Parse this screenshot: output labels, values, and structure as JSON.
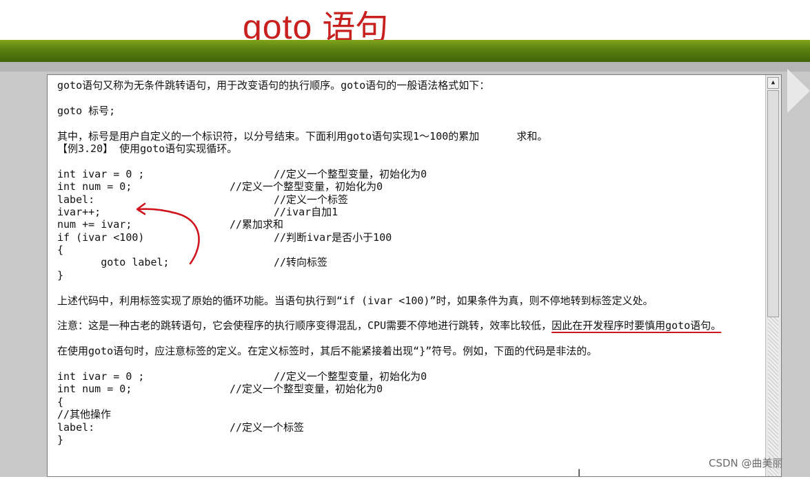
{
  "slide": {
    "title_latin": "goto",
    "title_cjk": "语句"
  },
  "doc": {
    "p1": "goto语句又称为无条件跳转语句，用于改变语句的执行顺序。goto语句的一般语法格式如下：",
    "syntax": "goto 标号;",
    "p2": "其中，标号是用户自定义的一个标识符，以分号结束。下面利用goto语句实现1～100的累加      求和。",
    "example_title": "【例3.20】 使用goto语句实现循环。",
    "code1": [
      {
        "code": "int ivar = 0 ;",
        "comment": "//定义一个整型变量，初始化为0",
        "col": "c1"
      },
      {
        "code": "int num = 0;",
        "comment": "//定义一个整型变量，初始化为0",
        "col": "c2"
      },
      {
        "code": "label:",
        "comment": "//定义一个标签",
        "col": "c1"
      },
      {
        "code": "ivar++;",
        "comment": "//ivar自加1",
        "col": "c1"
      },
      {
        "code": "num += ivar;",
        "comment": "//累加求和",
        "col": "c2"
      },
      {
        "code": "if (ivar <100)",
        "comment": "//判断ivar是否小于100",
        "col": "c1"
      },
      {
        "code": "{",
        "comment": "",
        "col": "c1"
      },
      {
        "code": "       goto label;",
        "comment": "//转向标签",
        "col": "c1"
      },
      {
        "code": "}",
        "comment": "",
        "col": "c1"
      }
    ],
    "p3": "上述代码中，利用标签实现了原始的循环功能。当语句执行到“if (ivar <100)”时，如果条件为真，则不停地转到标签定义处。",
    "note_part1": "  注意：这是一种古老的跳转语句，它会使程序的执行顺序变得混乱，CPU需要不停地进行跳转，效率比较低，",
    "note_part2": "因此在开发程序时要慎用goto语句。",
    "p4": "在使用goto语句时，应注意标签的定义。在定义标签时，其后不能紧接着出现“}”符号。例如，下面的代码是非法的。",
    "code2": [
      {
        "code": "int ivar = 0 ;",
        "comment": "//定义一个整型变量，初始化为0",
        "col": "c1"
      },
      {
        "code": "int num = 0;",
        "comment": "//定义一个整型变量，初始化为0",
        "col": "c2"
      },
      {
        "code": "{",
        "comment": "",
        "col": "c1"
      },
      {
        "code": "//其他操作",
        "comment": "",
        "col": "c1"
      },
      {
        "code": "label:",
        "comment": "//定义一个标签",
        "col": "c2"
      },
      {
        "code": "}",
        "comment": "",
        "col": "c1"
      }
    ]
  },
  "scrollbar": {
    "up_glyph": "▲"
  },
  "watermark": "CSDN @曲美丽",
  "colors": {
    "title_red": "#c8201e",
    "bar_green": "#5a7e10",
    "annotation_red": "#d0141e"
  }
}
